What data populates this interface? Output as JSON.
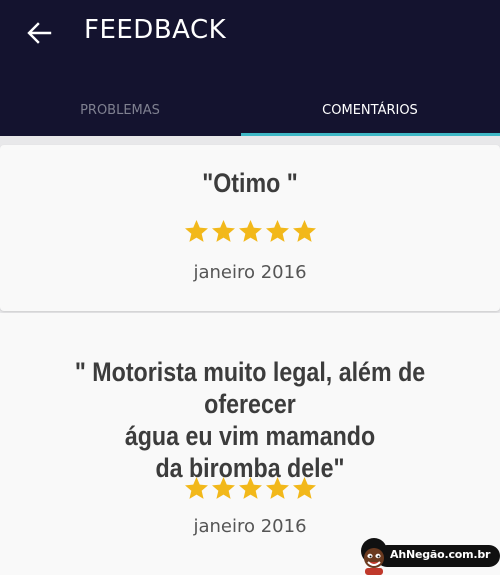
{
  "header": {
    "title": "FEEDBACK",
    "back_icon": "arrow-left-icon",
    "background": "#14132f"
  },
  "tabs": [
    {
      "label": "PROBLEMAS",
      "active": false
    },
    {
      "label": "COMENTÁRIOS",
      "active": true
    }
  ],
  "accent_color": "#3fb8c6",
  "star_color": "#f2b81a",
  "feedback": [
    {
      "comment": "\"Otimo \"",
      "rating": 5,
      "date": "janeiro 2016"
    },
    {
      "comment": "\" Motorista muito legal, além de oferecer\nágua eu vim mamando\n  da biromba dele\"",
      "rating": 5,
      "date": "janeiro 2016"
    }
  ],
  "watermark": {
    "text": "AhNegão.com.br"
  }
}
